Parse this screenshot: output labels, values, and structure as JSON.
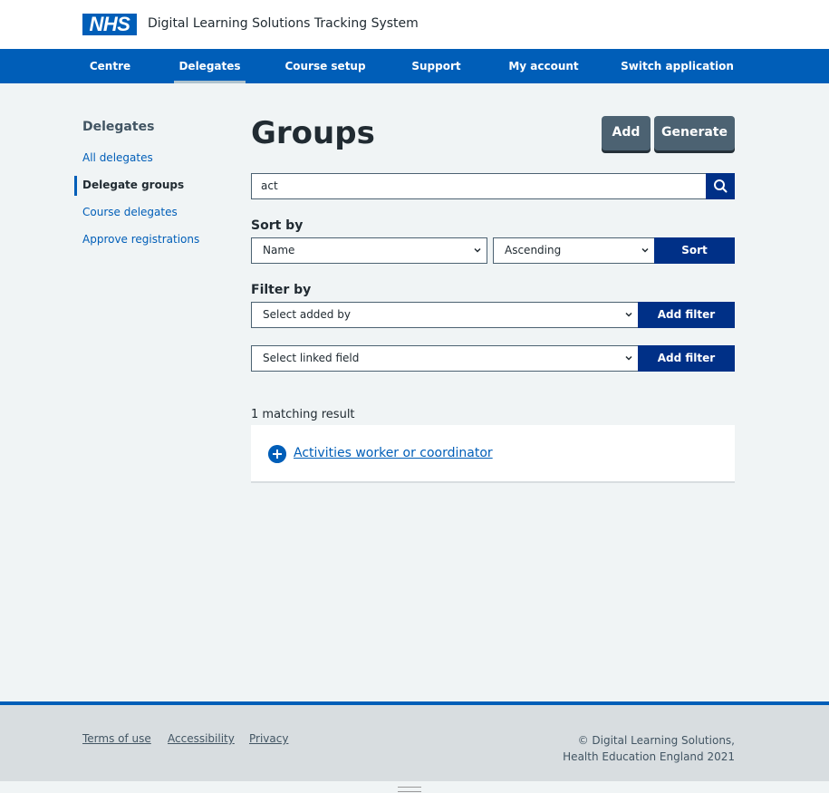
{
  "header": {
    "logo_text": "NHS",
    "service_name": "Digital Learning Solutions Tracking System"
  },
  "nav": {
    "items": [
      "Centre",
      "Delegates",
      "Course setup",
      "Support",
      "My account",
      "Switch application"
    ],
    "active": "Delegates"
  },
  "sidebar": {
    "title": "Delegates",
    "items": [
      {
        "label": "All delegates"
      },
      {
        "label": "Delegate groups",
        "current": true
      },
      {
        "label": "Course delegates"
      },
      {
        "label": "Approve registrations"
      }
    ]
  },
  "main": {
    "title": "Groups",
    "add_label": "Add",
    "generate_label": "Generate",
    "search": {
      "value": "act",
      "icon": "search-icon"
    },
    "sort": {
      "label": "Sort by",
      "field": "Name",
      "direction": "Ascending",
      "button": "Sort"
    },
    "filter": {
      "label": "Filter by",
      "added_by": "Select added by",
      "linked_field": "Select linked field",
      "button": "Add filter"
    },
    "results": {
      "count_text": "1 matching result",
      "items": [
        {
          "name": "Activities worker or coordinator"
        }
      ]
    }
  },
  "footer": {
    "links": [
      "Terms of use",
      "Accessibility",
      "Privacy"
    ],
    "copyright_line1": "© Digital Learning Solutions,",
    "copyright_line2": "Health Education England 2021"
  },
  "colors": {
    "nhs_blue": "#005eb8",
    "dark_blue": "#003087",
    "secondary": "#4c6272",
    "background": "#f0f4f5"
  }
}
